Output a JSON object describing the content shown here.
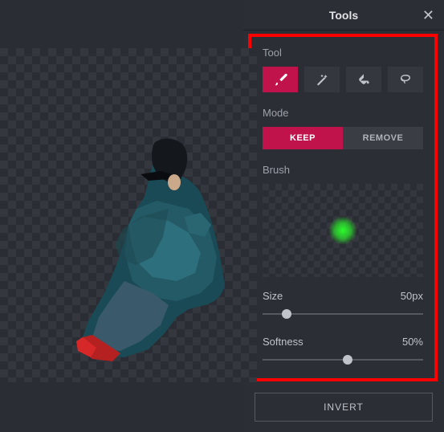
{
  "panel": {
    "title": "Tools"
  },
  "sections": {
    "tool_label": "Tool",
    "mode_label": "Mode",
    "brush_label": "Brush"
  },
  "mode": {
    "keep": "KEEP",
    "remove": "REMOVE"
  },
  "sliders": {
    "size": {
      "label": "Size",
      "value": "50px",
      "pos_pct": 12
    },
    "softness": {
      "label": "Softness",
      "value": "50%",
      "pos_pct": 50
    }
  },
  "buttons": {
    "invert": "INVERT"
  },
  "icons": {
    "brush": "brush-icon",
    "wand": "wand-icon",
    "bucket": "bucket-icon",
    "lasso": "lasso-icon",
    "close": "close-icon"
  },
  "colors": {
    "accent": "#c0134b",
    "brush_preview": "#2bff2b",
    "highlight": "#ff0000"
  }
}
